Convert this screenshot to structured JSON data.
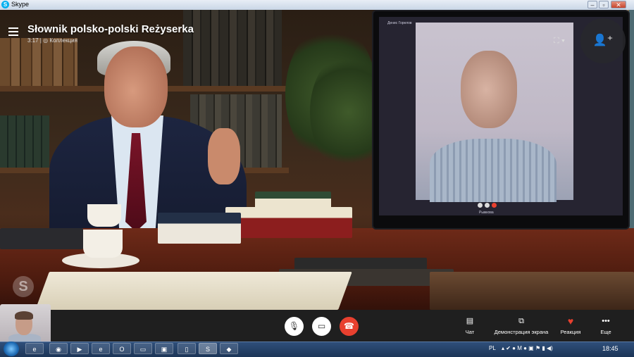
{
  "window": {
    "title": "Skype",
    "app_icon": "skype-icon",
    "controls": [
      "minimize",
      "maximize",
      "close"
    ]
  },
  "conversation": {
    "title": "Słownik polsko-polski Reżyserka",
    "duration": "3:17",
    "separator": "|",
    "collection_label": "Коллекция"
  },
  "monitor_screen": {
    "caller_name": "Денис Горелов",
    "call_label": "Рыжкова"
  },
  "callbar": {
    "mic_icon": "microphone-icon",
    "video_icon": "video-camera-icon",
    "hangup_icon": "hang-up-icon",
    "chat_label": "Чат",
    "screenshare_label": "Демонстрация экрана",
    "reaction_label": "Реакция",
    "more_label": "Еще"
  },
  "taskbar": {
    "language": "PL",
    "time": "18:45",
    "apps": [
      "internet-explorer",
      "chrome",
      "media-player",
      "internet-explorer",
      "opera",
      "folder",
      "remote-desktop",
      "documents",
      "skype",
      "media"
    ]
  },
  "colors": {
    "hangup": "#e8402f",
    "reaction_heart": "#e8402f",
    "callbar": "#1f1f1f",
    "taskbar": "#1c3557"
  }
}
